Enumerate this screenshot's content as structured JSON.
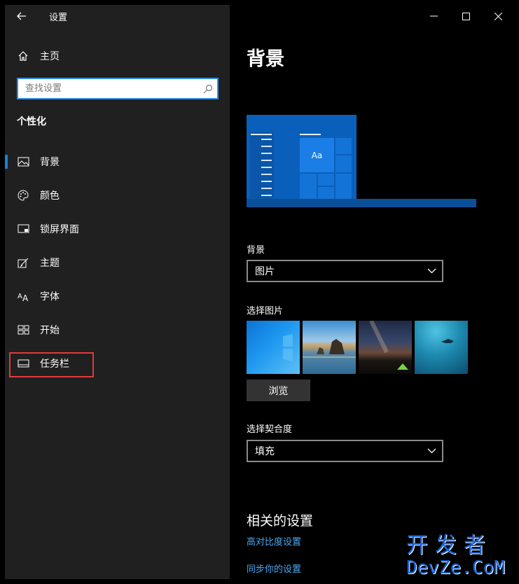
{
  "window": {
    "title": "设置",
    "caption": {
      "minimize": "—",
      "maximize": "☐",
      "close": "✕"
    }
  },
  "sidebar": {
    "home_label": "主页",
    "search_placeholder": "查找设置",
    "section_title": "个性化",
    "items": [
      {
        "label": "背景",
        "icon": "picture-icon",
        "selected": true
      },
      {
        "label": "颜色",
        "icon": "palette-icon"
      },
      {
        "label": "锁屏界面",
        "icon": "lock-screen-icon"
      },
      {
        "label": "主题",
        "icon": "theme-brush-icon"
      },
      {
        "label": "字体",
        "icon": "font-icon"
      },
      {
        "label": "开始",
        "icon": "start-icon"
      },
      {
        "label": "任务栏",
        "icon": "taskbar-icon",
        "highlighted": true
      }
    ]
  },
  "main": {
    "page_title": "背景",
    "preview_text": "Aa",
    "background_label": "背景",
    "background_value": "图片",
    "choose_picture_label": "选择图片",
    "browse_label": "浏览",
    "fit_label": "选择契合度",
    "fit_value": "填充",
    "related_title": "相关的设置",
    "links": [
      "高对比度设置",
      "同步你的设置"
    ]
  },
  "watermark": {
    "cn": "开发者",
    "en": "DevZe.CoM"
  },
  "colors": {
    "accent": "#1e7fd8",
    "sidebar_bg": "#202020",
    "main_bg": "#000000",
    "link": "#4aa8f0",
    "highlight_border": "#e23a3a"
  }
}
